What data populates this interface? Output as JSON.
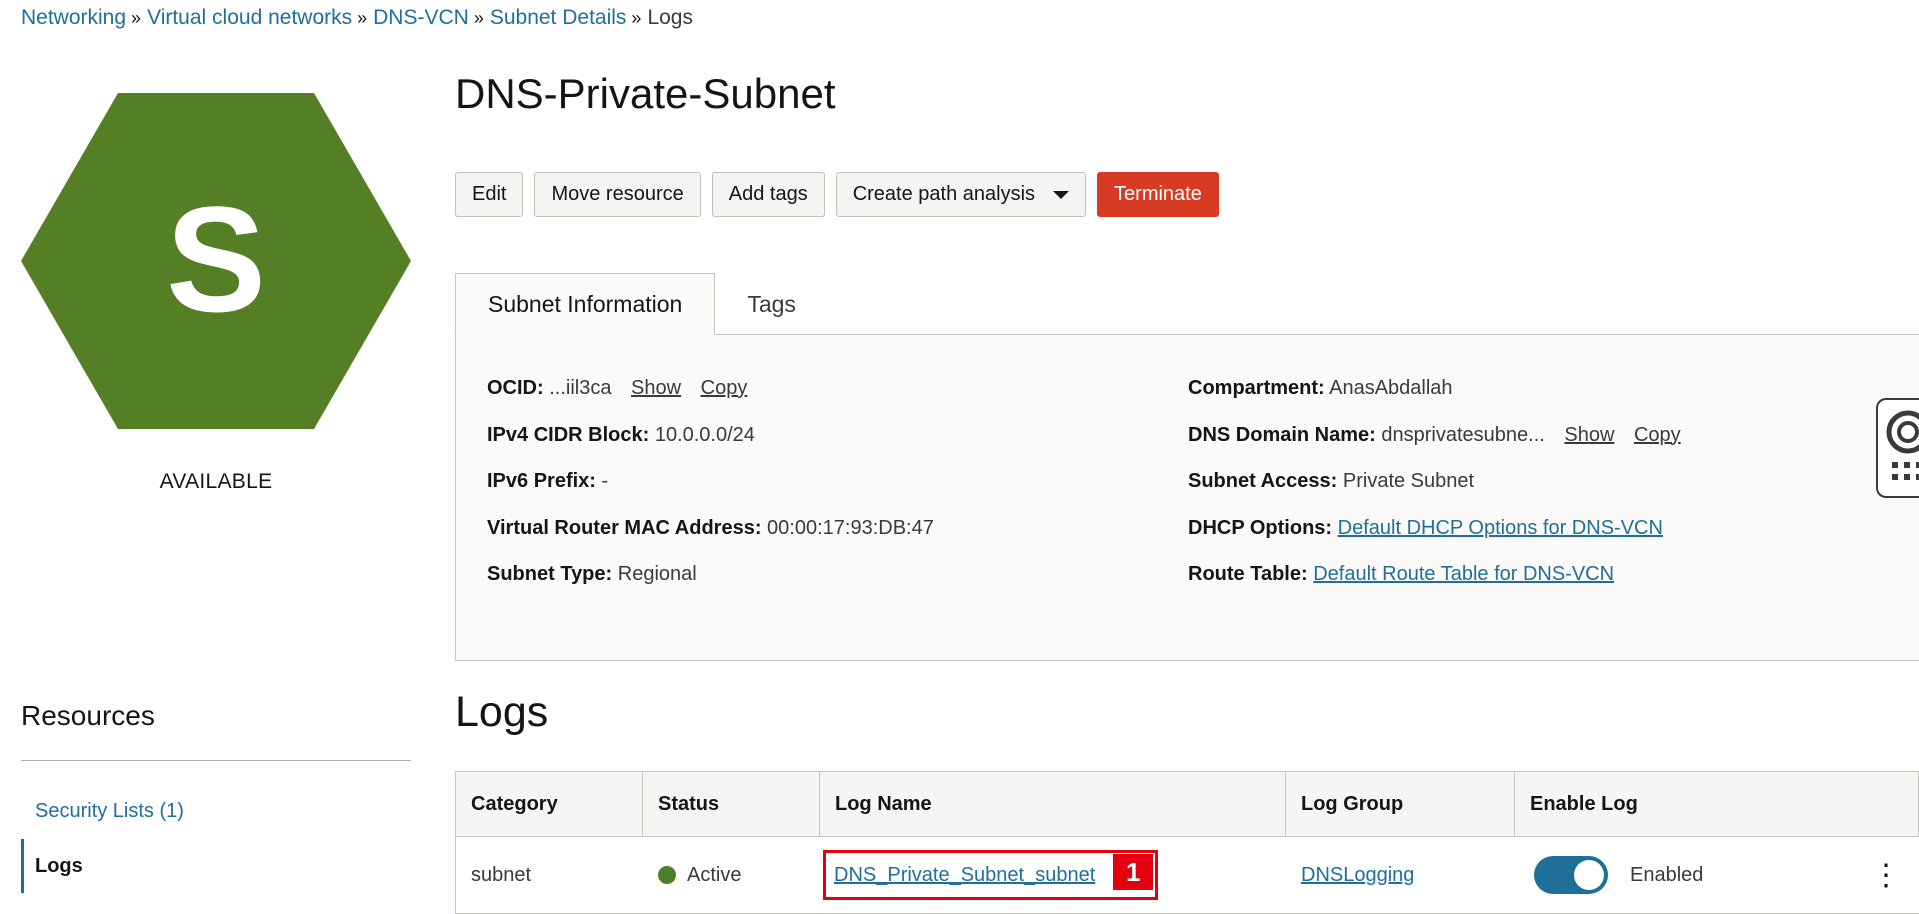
{
  "breadcrumb": {
    "items": [
      "Networking",
      "Virtual cloud networks",
      "DNS-VCN",
      "Subnet Details"
    ],
    "current": "Logs",
    "separator": "»"
  },
  "resource_icon": {
    "letter": "S",
    "color": "#557f24",
    "status": "AVAILABLE"
  },
  "header": {
    "title": "DNS-Private-Subnet"
  },
  "actions": {
    "edit": "Edit",
    "move": "Move resource",
    "add_tags": "Add tags",
    "path_analysis": "Create path analysis",
    "terminate": "Terminate"
  },
  "tabs": [
    {
      "label": "Subnet Information",
      "active": true
    },
    {
      "label": "Tags",
      "active": false
    }
  ],
  "info": {
    "left": {
      "ocid_label": "OCID:",
      "ocid_value": "...iil3ca",
      "show": "Show",
      "copy": "Copy",
      "ipv4_label": "IPv4 CIDR Block:",
      "ipv4_value": "10.0.0.0/24",
      "ipv6_label": "IPv6 Prefix:",
      "ipv6_value": "-",
      "mac_label": "Virtual Router MAC Address:",
      "mac_value": "00:00:17:93:DB:47",
      "type_label": "Subnet Type:",
      "type_value": "Regional"
    },
    "right": {
      "compartment_label": "Compartment:",
      "compartment_value": "AnasAbdallah",
      "dns_label": "DNS Domain Name:",
      "dns_value": "dnsprivatesubne...",
      "show": "Show",
      "copy": "Copy",
      "access_label": "Subnet Access:",
      "access_value": "Private Subnet",
      "dhcp_label": "DHCP Options:",
      "dhcp_value": "Default DHCP Options for DNS-VCN",
      "route_label": "Route Table:",
      "route_value": "Default Route Table for DNS-VCN"
    }
  },
  "resources": {
    "title": "Resources",
    "items": [
      {
        "label": "Security Lists (1)",
        "active": false
      },
      {
        "label": "Logs",
        "active": true
      }
    ]
  },
  "logs": {
    "title": "Logs",
    "columns": [
      "Category",
      "Status",
      "Log Name",
      "Log Group",
      "Enable Log"
    ],
    "rows": [
      {
        "category": "subnet",
        "status": "Active",
        "log_name": "DNS_Private_Subnet_subnet",
        "log_group": "DNSLogging",
        "enabled_label": "Enabled",
        "enabled": true
      }
    ],
    "annotation_badge": "1",
    "colors": {
      "active_status": "#4f7d28",
      "toggle_on": "#1f6f99",
      "annotation": "#e3000f"
    }
  }
}
